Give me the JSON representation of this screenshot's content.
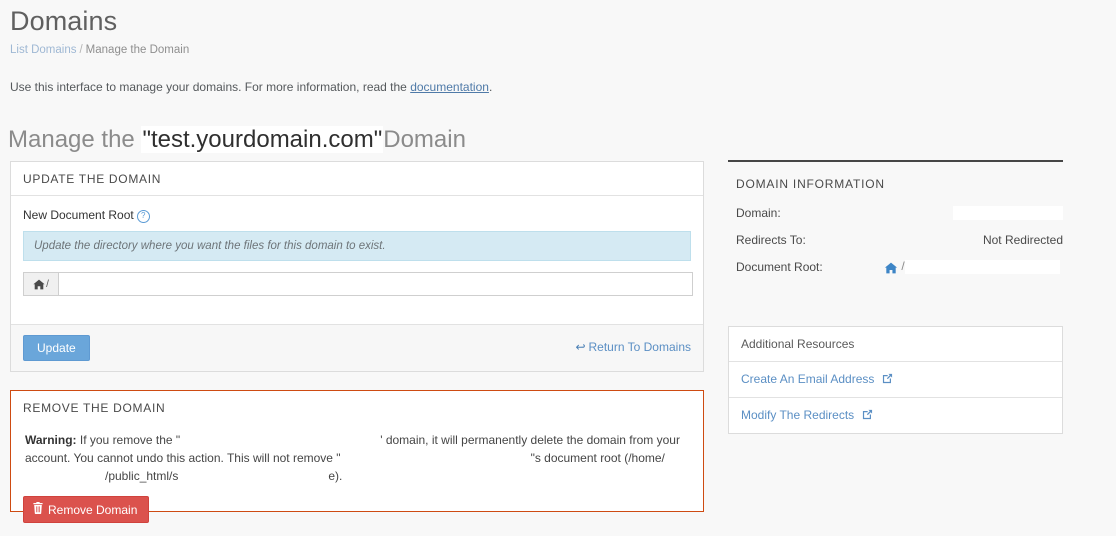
{
  "header": {
    "title": "Domains",
    "breadcrumb": {
      "link": "List Domains",
      "separator": "/",
      "current": "Manage the Domain"
    },
    "intro_before": "Use this interface to manage your domains. For more information, read the ",
    "intro_link": "documentation",
    "intro_after": ".",
    "manage_prefix": "Manage the ",
    "manage_domain": "\"test.yourdomain.com\"",
    "manage_suffix": "Domain"
  },
  "update_panel": {
    "heading": "UPDATE THE DOMAIN",
    "field_label": "New Document Root",
    "help_icon": "question-circle-icon",
    "help_glyph": "?",
    "alert_text": "Update the directory where you want the files for this domain to exist.",
    "addon_icon": "home-icon",
    "addon_slash": "/",
    "input_value": "",
    "input_placeholder": "",
    "update_label": "Update",
    "return_label": "Return To Domains",
    "return_icon": "back-arrow-icon",
    "return_glyph": "↩"
  },
  "remove_panel": {
    "heading": "REMOVE THE DOMAIN",
    "warning_label": "Warning:",
    "warning_part1": " If you remove the \"",
    "warning_redacted1": "",
    "warning_part2": "' domain, it will permanently delete the domain from your account. You cannot undo this action. This will not remove \"",
    "warning_redacted2": "",
    "warning_part3": "\"s document root (/home/",
    "warning_redacted3": "",
    "warning_part4": "/public_html/s",
    "warning_redacted4": "",
    "warning_part5": "e).",
    "remove_label": "Remove Domain",
    "remove_icon": "trash-icon"
  },
  "domain_info": {
    "heading": "DOMAIN INFORMATION",
    "rows": [
      {
        "label": "Domain:",
        "value": "",
        "redacted": true,
        "icon": ""
      },
      {
        "label": "Redirects To:",
        "value": "Not Redirected",
        "redacted": false,
        "icon": ""
      },
      {
        "label": "Document Root:",
        "value": "",
        "redacted": true,
        "icon": "home-icon",
        "slash": "/"
      }
    ]
  },
  "resources": {
    "heading": "Additional Resources",
    "items": [
      {
        "label": "Create An Email Address",
        "icon": "external-link-icon"
      },
      {
        "label": "Modify The Redirects",
        "icon": "external-link-icon"
      }
    ]
  },
  "colors": {
    "page_bg": "#f8f8f8",
    "panel_border": "#dcdcdc",
    "update_button": "#6aa6da",
    "remove_button": "#db524d",
    "remove_panel_border": "#ce4b12",
    "alert_info_bg": "#d5eaf3",
    "link_blue": "#5b8fc4",
    "home_icon_blue": "#3d85c6"
  }
}
